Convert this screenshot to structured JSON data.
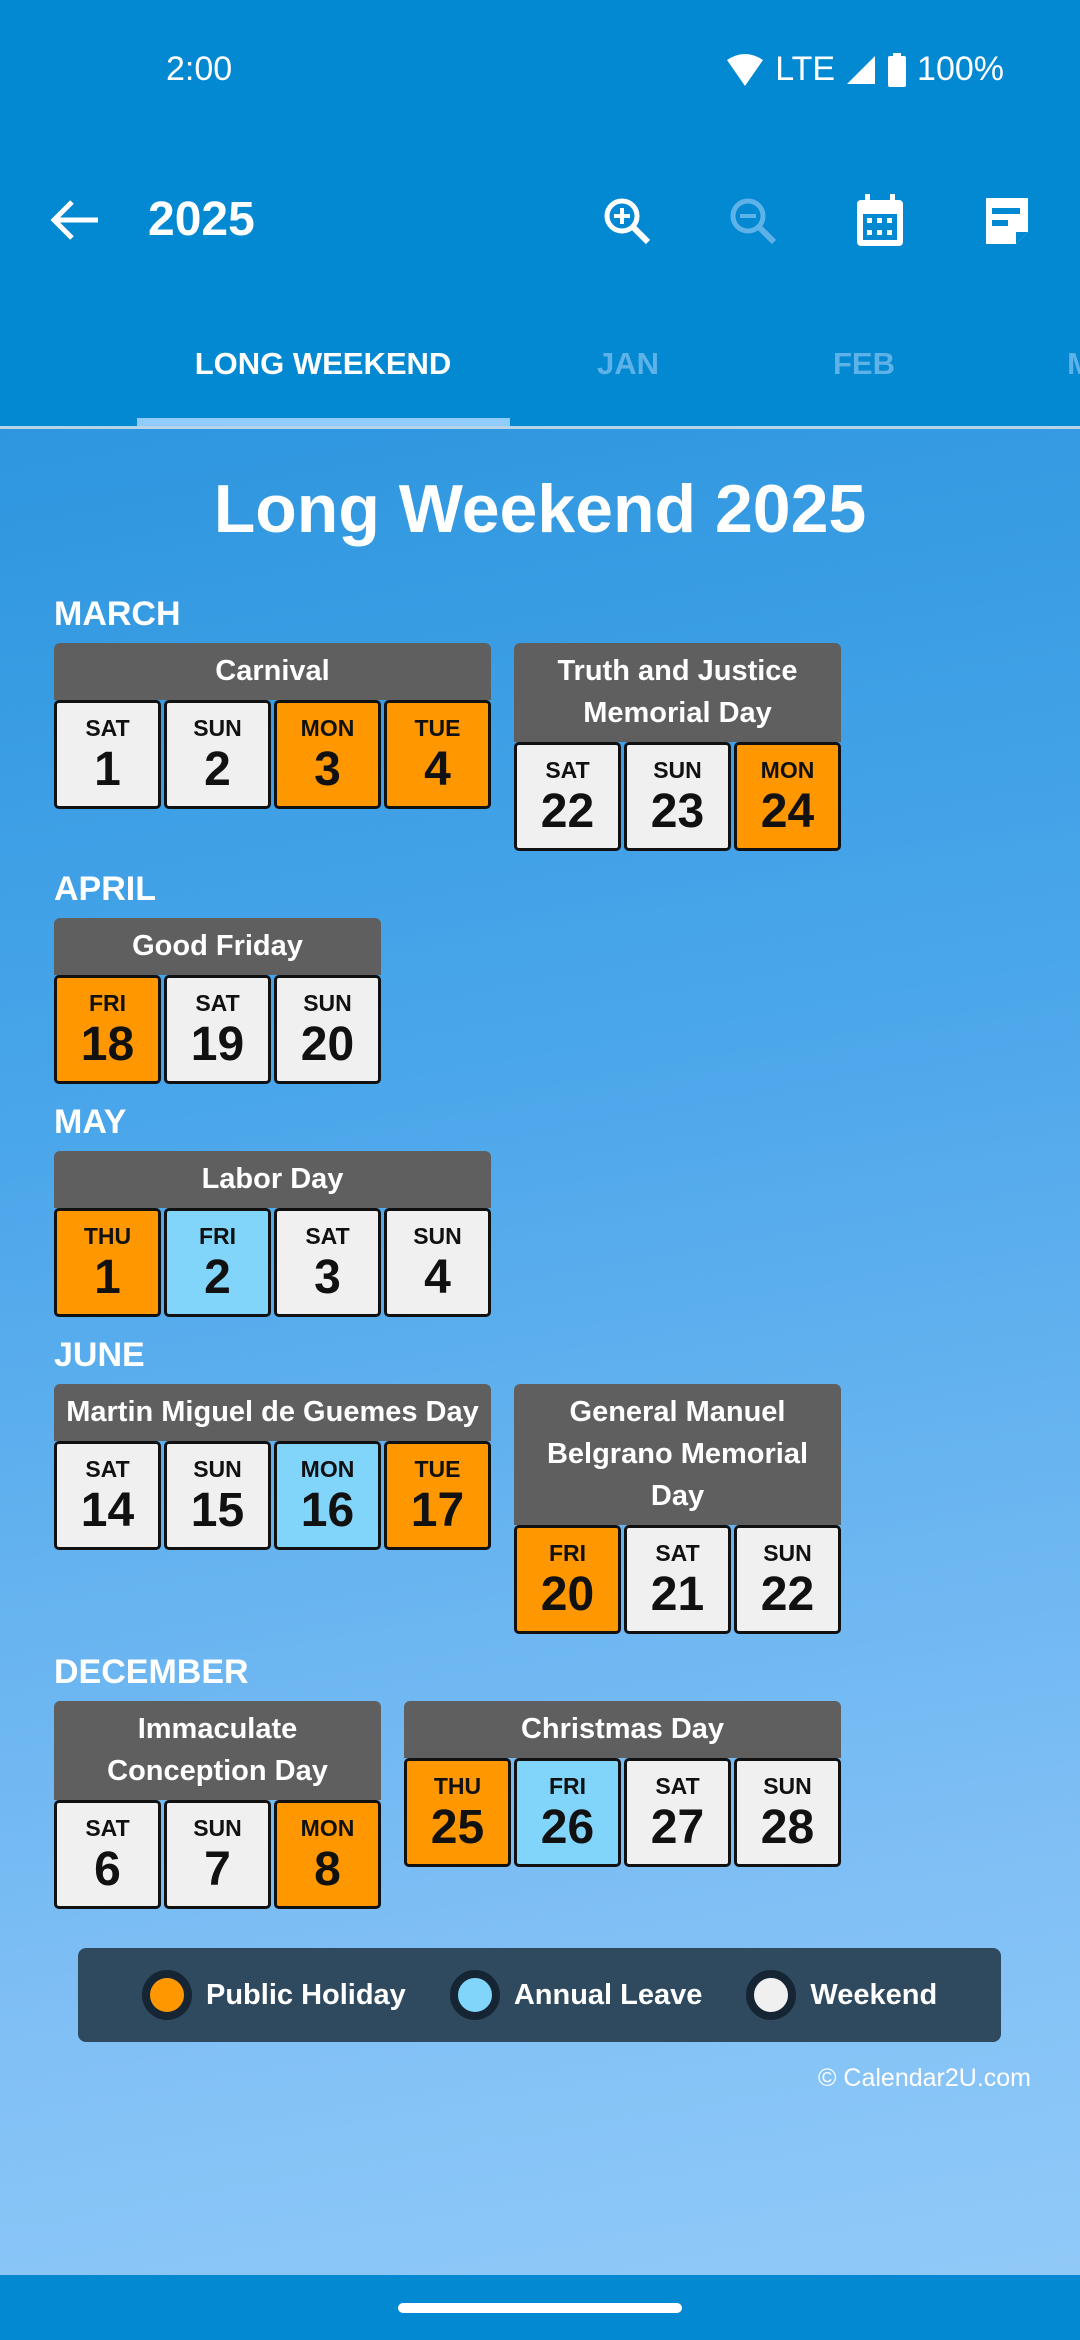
{
  "status": {
    "time": "2:00",
    "network": "LTE",
    "battery": "100%"
  },
  "toolbar": {
    "title": "2025",
    "icons": [
      "back-arrow-icon",
      "zoom-in-icon",
      "zoom-out-icon",
      "calendar-icon",
      "note-icon"
    ]
  },
  "tabs": [
    {
      "label": "LONG WEEKEND",
      "active": true
    },
    {
      "label": "JAN"
    },
    {
      "label": "FEB"
    },
    {
      "label": "M"
    }
  ],
  "page_title": "Long Weekend 2025",
  "colors": {
    "holiday": "#ff9800",
    "leave": "#81d4fa",
    "weekend": "#f0f0f0",
    "header": "#0388d2"
  },
  "months": [
    {
      "name": "MARCH",
      "cards": [
        {
          "title": "Carnival",
          "days": [
            {
              "d": "SAT",
              "n": "1",
              "t": "weekend"
            },
            {
              "d": "SUN",
              "n": "2",
              "t": "weekend"
            },
            {
              "d": "MON",
              "n": "3",
              "t": "holiday"
            },
            {
              "d": "TUE",
              "n": "4",
              "t": "holiday"
            }
          ]
        },
        {
          "title": "Truth and Justice Memorial Day",
          "days": [
            {
              "d": "SAT",
              "n": "22",
              "t": "weekend"
            },
            {
              "d": "SUN",
              "n": "23",
              "t": "weekend"
            },
            {
              "d": "MON",
              "n": "24",
              "t": "holiday"
            }
          ]
        }
      ]
    },
    {
      "name": "APRIL",
      "cards": [
        {
          "title": "Good Friday",
          "days": [
            {
              "d": "FRI",
              "n": "18",
              "t": "holiday"
            },
            {
              "d": "SAT",
              "n": "19",
              "t": "weekend"
            },
            {
              "d": "SUN",
              "n": "20",
              "t": "weekend"
            }
          ]
        }
      ]
    },
    {
      "name": "MAY",
      "cards": [
        {
          "title": "Labor Day",
          "days": [
            {
              "d": "THU",
              "n": "1",
              "t": "holiday"
            },
            {
              "d": "FRI",
              "n": "2",
              "t": "leave"
            },
            {
              "d": "SAT",
              "n": "3",
              "t": "weekend"
            },
            {
              "d": "SUN",
              "n": "4",
              "t": "weekend"
            }
          ]
        }
      ]
    },
    {
      "name": "JUNE",
      "cards": [
        {
          "title": "Martin Miguel de Guemes Day",
          "days": [
            {
              "d": "SAT",
              "n": "14",
              "t": "weekend"
            },
            {
              "d": "SUN",
              "n": "15",
              "t": "weekend"
            },
            {
              "d": "MON",
              "n": "16",
              "t": "leave"
            },
            {
              "d": "TUE",
              "n": "17",
              "t": "holiday"
            }
          ]
        },
        {
          "title": "General Manuel Belgrano Memorial Day",
          "days": [
            {
              "d": "FRI",
              "n": "20",
              "t": "holiday"
            },
            {
              "d": "SAT",
              "n": "21",
              "t": "weekend"
            },
            {
              "d": "SUN",
              "n": "22",
              "t": "weekend"
            }
          ]
        }
      ]
    },
    {
      "name": "DECEMBER",
      "cards": [
        {
          "title": "Immaculate Conception Day",
          "days": [
            {
              "d": "SAT",
              "n": "6",
              "t": "weekend"
            },
            {
              "d": "SUN",
              "n": "7",
              "t": "weekend"
            },
            {
              "d": "MON",
              "n": "8",
              "t": "holiday"
            }
          ]
        },
        {
          "title": "Christmas Day",
          "days": [
            {
              "d": "THU",
              "n": "25",
              "t": "holiday"
            },
            {
              "d": "FRI",
              "n": "26",
              "t": "leave"
            },
            {
              "d": "SAT",
              "n": "27",
              "t": "weekend"
            },
            {
              "d": "SUN",
              "n": "28",
              "t": "weekend"
            }
          ]
        }
      ]
    }
  ],
  "legend": [
    {
      "label": "Public Holiday",
      "type": "holiday"
    },
    {
      "label": "Annual Leave",
      "type": "leave"
    },
    {
      "label": "Weekend",
      "type": "weekend"
    }
  ],
  "copyright": "© Calendar2U.com"
}
